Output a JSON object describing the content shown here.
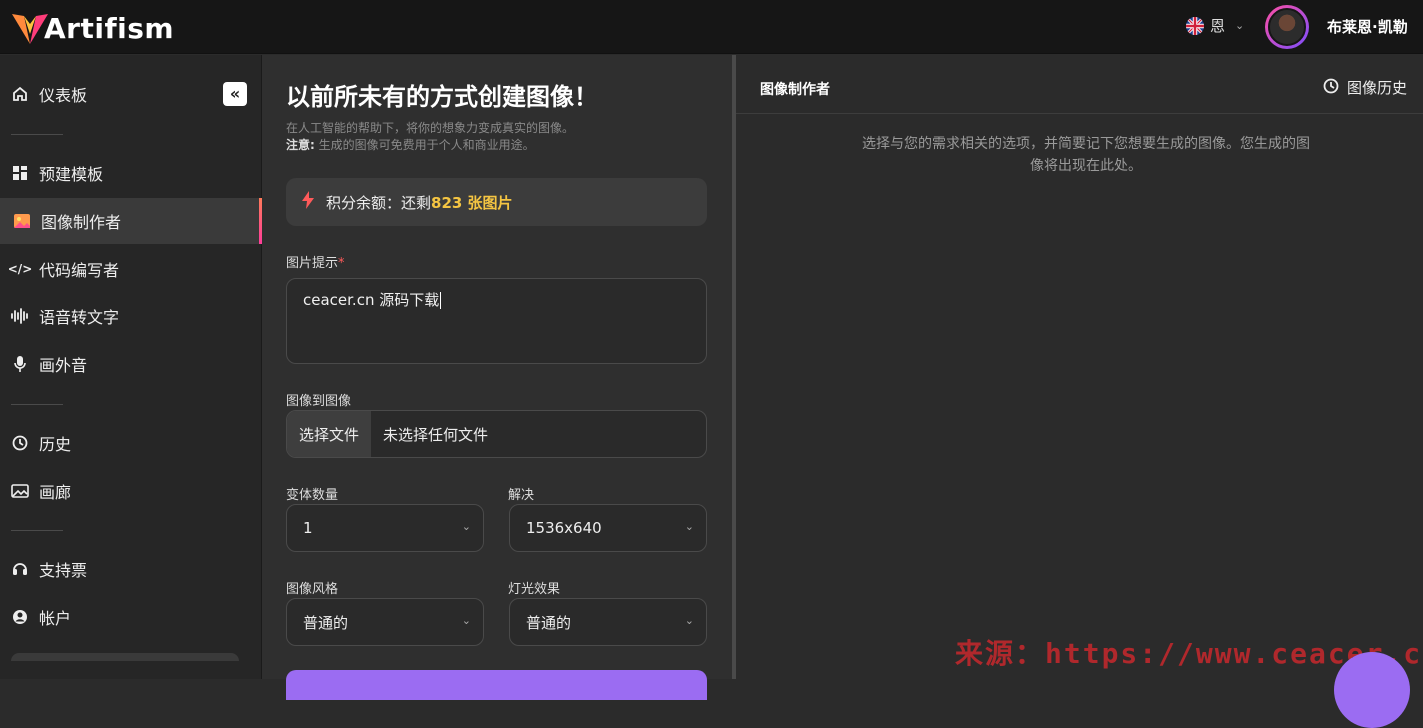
{
  "brand": {
    "name": "Artifism"
  },
  "header": {
    "language": "恩",
    "user_name": "布莱恩·凯勒"
  },
  "sidebar": {
    "items": [
      {
        "label": "仪表板",
        "icon": "dashboard-icon"
      },
      {
        "label": "预建模板",
        "icon": "grid-icon"
      },
      {
        "label": "图像制作者",
        "icon": "image-icon",
        "active": true
      },
      {
        "label": "代码编写者",
        "icon": "code-icon"
      },
      {
        "label": "语音转文字",
        "icon": "waveform-icon"
      },
      {
        "label": "画外音",
        "icon": "microphone-icon"
      },
      {
        "label": "历史",
        "icon": "history-icon"
      },
      {
        "label": "画廊",
        "icon": "gallery-icon"
      },
      {
        "label": "支持票",
        "icon": "headset-icon"
      },
      {
        "label": "帐户",
        "icon": "user-icon"
      }
    ],
    "collapse_label": "«"
  },
  "main": {
    "title": "以前所未有的方式创建图像！",
    "subtitle": "在人工智能的帮助下，将你的想象力变成真实的图像。",
    "note_label": "注意:",
    "note_text": "生成的图像可免费用于个人和商业用途。",
    "credits_label": "积分余额：还剩",
    "credits_value": "823 张图片",
    "prompt_label": "图片提示",
    "prompt_required": "*",
    "prompt_value": "ceacer.cn 源码下载",
    "img2img_label": "图像到图像",
    "file_button": "选择文件",
    "file_status": "未选择任何文件",
    "variants_label": "变体数量",
    "variants_value": "1",
    "resolution_label": "解决",
    "resolution_value": "1536x640",
    "style_label": "图像风格",
    "style_value": "普通的",
    "lighting_label": "灯光效果",
    "lighting_value": "普通的"
  },
  "right_panel": {
    "title": "图像制作者",
    "history_label": "图像历史",
    "placeholder": "选择与您的需求相关的选项，并简要记下您想要生成的图像。您生成的图像将出现在此处。"
  },
  "watermark": "来源：https://www.ceacer.cn"
}
